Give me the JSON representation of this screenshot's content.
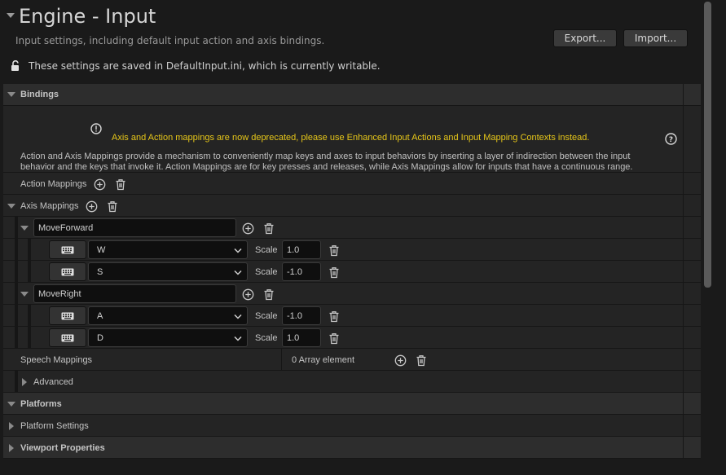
{
  "header": {
    "title": "Engine - Input",
    "subtitle": "Input settings, including default input action and axis bindings.",
    "export_label": "Export...",
    "import_label": "Import...",
    "saved_notice": "These settings are saved in DefaultInput.ini, which is currently writable."
  },
  "bindings": {
    "label": "Bindings",
    "warning": "Axis and Action mappings are now deprecated, please use Enhanced Input Actions and Input Mapping Contexts instead.",
    "description_line1": "Action and Axis Mappings provide a mechanism to conveniently map keys and axes to input behaviors by inserting a layer of indirection between the input",
    "description_line2": "behavior and the keys that invoke it. Action Mappings are for key presses and releases, while Axis Mappings allow for inputs that have a continuous range.",
    "action_mappings_label": "Action Mappings",
    "axis_mappings_label": "Axis Mappings",
    "scale_label": "Scale",
    "axes": [
      {
        "name": "MoveForward",
        "keys": [
          {
            "key": "W",
            "scale": "1.0"
          },
          {
            "key": "S",
            "scale": "-1.0"
          }
        ]
      },
      {
        "name": "MoveRight",
        "keys": [
          {
            "key": "A",
            "scale": "-1.0"
          },
          {
            "key": "D",
            "scale": "1.0"
          }
        ]
      }
    ],
    "speech_mappings_label": "Speech Mappings",
    "speech_mappings_value": "0 Array element",
    "advanced_label": "Advanced"
  },
  "platforms": {
    "label": "Platforms",
    "platform_settings_label": "Platform Settings"
  },
  "viewport": {
    "label": "Viewport Properties"
  },
  "colors": {
    "warning_text": "#e6c619",
    "background": "#1a1a1a",
    "category": "#2d2d2d"
  }
}
